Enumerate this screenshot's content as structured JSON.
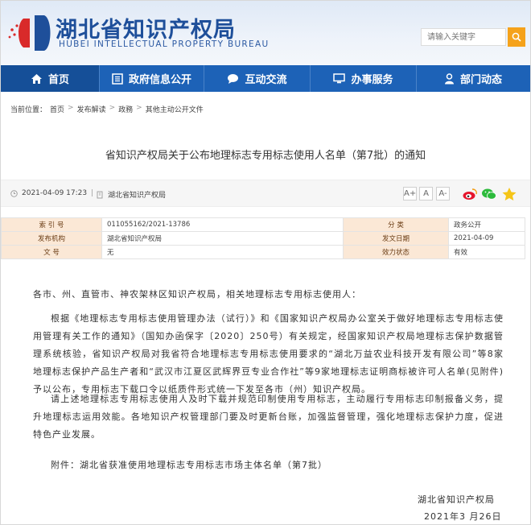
{
  "header": {
    "site_name_cn": "湖北省知识产权局",
    "site_name_en": "HUBEI INTELLECTUAL PROPERTY BUREAU",
    "search_placeholder": "请输入关键字"
  },
  "nav": {
    "items": [
      {
        "label": "首页",
        "icon": "home-icon"
      },
      {
        "label": "政府信息公开",
        "icon": "document-icon"
      },
      {
        "label": "互动交流",
        "icon": "chat-icon"
      },
      {
        "label": "办事服务",
        "icon": "monitor-icon"
      },
      {
        "label": "部门动态",
        "icon": "user-icon"
      }
    ]
  },
  "breadcrumb": {
    "prefix": "当前位置：",
    "items": [
      "首页",
      "发布解读",
      "政務",
      "其他主动公开文件"
    ],
    "separator": ">"
  },
  "article": {
    "title": "省知识产权局关于公布地理标志专用标志使用人名单（第7批）的通知",
    "date": "2021-04-09 17:23",
    "divider": "|",
    "source": "湖北省知识产权局",
    "font_sizes": [
      "A+",
      "A",
      "A-"
    ]
  },
  "info_table": {
    "rows": [
      {
        "label1": "索 引 号",
        "value1": "011055162/2021-13786",
        "label2": "分 类",
        "value2": "政务公开"
      },
      {
        "label1": "发布机构",
        "value1": "湖北省知识产权局",
        "label2": "发文日期",
        "value2": "2021-04-09"
      },
      {
        "label1": "文 号",
        "value1": "无",
        "label2": "效力状态",
        "value2": "有效"
      }
    ]
  },
  "body": {
    "greeting": "各市、州、直管市、神农架林区知识产权局，相关地理标志专用标志使用人：",
    "para1": "根据《地理标志专用标志使用管理办法（试行）》和《国家知识产权局办公室关于做好地理标志专用标志使用管理有关工作的通知》（国知办函保字〔2020〕250号）有关规定，经国家知识产权局地理标志保护数据管理系统核验，省知识产权局对我省符合地理标志专用标志使用要求的“湖北万益农业科技开发有限公司”等8家地理标志保护产品生产者和“武汉市江夏区武辉界豆专业合作社”等9家地理标志证明商标被许可人名单(见附件)予以公布，专用标志下载口令以纸质件形式统一下发至各市（州）知识产权局。",
    "para2": "请上述地理标志专用标志使用人及时下载并规范印制使用专用标志，主动履行专用标志印制报备义务，提升地理标志运用效能。各地知识产权管理部门要及时更新台账，加强监督管理，强化地理标志保护力度，促进特色产业发展。",
    "attachment": "附件：湖北省获准使用地理标志专用标志市场主体名单（第7批）",
    "signature": "湖北省知识产权局",
    "sign_date": "2021年3  月26日"
  },
  "colors": {
    "nav_bg": "#1d62b7",
    "nav_active": "#154f98",
    "brand_blue": "#1e4f9a",
    "search_button": "#f5a21b",
    "table_label_bg": "#fbe8d6"
  }
}
